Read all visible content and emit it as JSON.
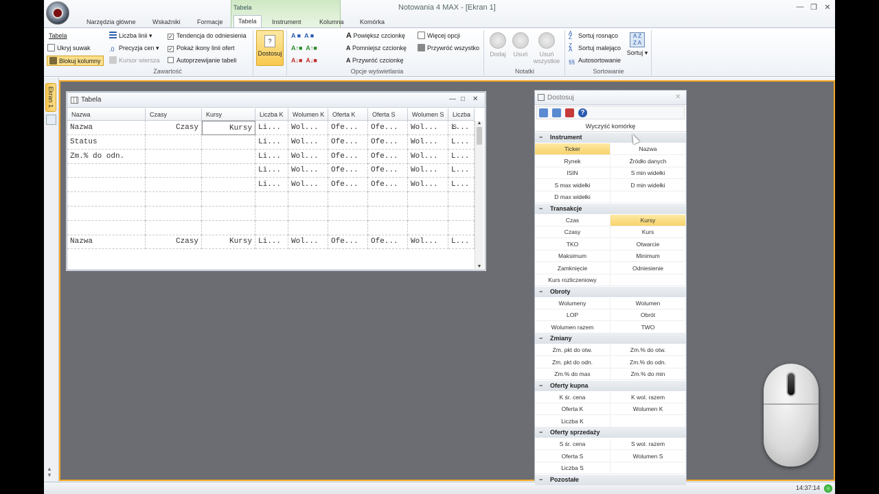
{
  "window": {
    "title": "Notowania 4 MAX - [Ekran 1]",
    "context_group": "Tabela"
  },
  "tabs": [
    "Narzędzia główne",
    "Wskaźniki",
    "Formacje",
    "Tabela",
    "Instrument",
    "Kolumna",
    "Komórka"
  ],
  "ribbon": {
    "col1": [
      "Tabela",
      "Ukryj suwak",
      "Blokuj kolumny"
    ],
    "col2": [
      "Liczba linii",
      "Precyzja cen",
      "Kursor wiersza"
    ],
    "col3": [
      "Tendencja do odniesienia",
      "Pokaż ikony linii ofert",
      "Autoprzewijanie tabeli"
    ],
    "dostosuj": "Dostosuj",
    "font": [
      "Powiększ czcionkę",
      "Pomniejsz czcionkę",
      "Przywróć czcionkę"
    ],
    "more": [
      "Więcej opcji",
      "Przywróć wszystko"
    ],
    "notes": [
      "Dodaj",
      "Usuń",
      "Usuń wszystkie"
    ],
    "sort": [
      "Sortuj rosnąco",
      "Sortuj malejąco",
      "Autosortowanie"
    ],
    "sort_big": "Sortuj",
    "sections": [
      "Zawartość",
      "Opcje wyświetlania",
      "Notatki",
      "Sortowanie"
    ]
  },
  "side": {
    "tab": "Ekran 1"
  },
  "status": {
    "clock": "14:37:14"
  },
  "tabela": {
    "title": "Tabela",
    "headers": [
      "Nazwa",
      "Czasy",
      "Kursy",
      "Liczba K",
      "Wolumen K",
      "Oferta K",
      "Oferta S",
      "Wolumen S",
      "Liczba S"
    ],
    "rows": [
      [
        "Nazwa",
        "Czasy",
        "Kursy",
        "Li...",
        "Wol...",
        "Ofe...",
        "Ofe...",
        "Wol...",
        "L..."
      ],
      [
        "Status",
        "",
        "",
        "Li...",
        "Wol...",
        "Ofe...",
        "Ofe...",
        "Wol...",
        "L..."
      ],
      [
        "  Zm.% do odn.",
        "",
        "",
        "Li...",
        "Wol...",
        "Ofe...",
        "Ofe...",
        "Wol...",
        "L..."
      ],
      [
        "",
        "",
        "",
        "Li...",
        "Wol...",
        "Ofe...",
        "Ofe...",
        "Wol...",
        "L..."
      ],
      [
        "",
        "",
        "",
        "Li...",
        "Wol...",
        "Ofe...",
        "Ofe...",
        "Wol...",
        "L..."
      ],
      [
        "",
        "",
        "",
        "",
        "",
        "",
        "",
        "",
        ""
      ],
      [
        "",
        "",
        "",
        "",
        "",
        "",
        "",
        "",
        ""
      ],
      [
        "",
        "",
        "",
        "",
        "",
        "",
        "",
        "",
        ""
      ],
      [
        "Nazwa",
        "Czasy",
        "Kursy",
        "Li...",
        "Wol...",
        "Ofe...",
        "Ofe...",
        "Wol...",
        "L..."
      ]
    ]
  },
  "dostosuj": {
    "title": "Dostosuj",
    "clear": "Wyczyść komórkę",
    "groups": [
      {
        "name": "Instrument",
        "items": [
          "Ticker",
          "Nazwa",
          "Rynek",
          "Źródło danych",
          "ISIN",
          "S min widełki",
          "S max widełki",
          "D min widełki",
          "D max widełki",
          ""
        ]
      },
      {
        "name": "Transakcje",
        "items": [
          "Czas",
          "Kursy",
          "Czasy",
          "Kurs",
          "TKO",
          "Otwarcie",
          "Maksimum",
          "Minimum",
          "Zamknięcie",
          "Odniesienie",
          "Kurs rozliczeniowy",
          ""
        ]
      },
      {
        "name": "Obroty",
        "items": [
          "Wolumeny",
          "Wolumen",
          "LOP",
          "Obrót",
          "Wolumen razem",
          "TWO"
        ]
      },
      {
        "name": "Zmiany",
        "items": [
          "Zm. pkt do otw.",
          "Zm.% do otw.",
          "Zm. pkt do odn.",
          "Zm.% do odn.",
          "Zm.% do max",
          "Zm.% do min"
        ]
      },
      {
        "name": "Oferty kupna",
        "items": [
          "K śr. cena",
          "K wol. razem",
          "Oferta K",
          "Wolumen K",
          "Liczba K",
          ""
        ]
      },
      {
        "name": "Oferty sprzedaży",
        "items": [
          "S śr. cena",
          "S wol. razem",
          "Oferta S",
          "Wolumen S",
          "Liczba S",
          ""
        ]
      },
      {
        "name": "Pozostałe",
        "items": []
      }
    ]
  }
}
